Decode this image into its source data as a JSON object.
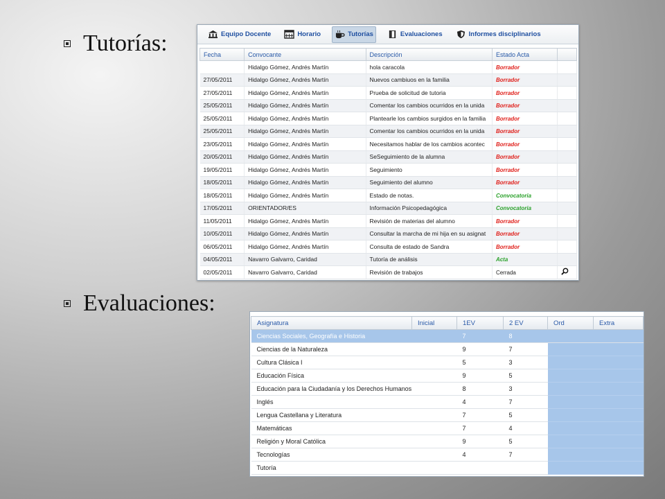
{
  "bullets": {
    "tutorias": "Tutorías:",
    "evaluaciones": "Evaluaciones:"
  },
  "toolbar": [
    {
      "label": "Equipo Docente",
      "icon": "building-icon"
    },
    {
      "label": "Horario",
      "icon": "calendar-icon"
    },
    {
      "label": "Tutorías",
      "icon": "coffee-icon",
      "active": true
    },
    {
      "label": "Evaluaciones",
      "icon": "book-icon"
    },
    {
      "label": "Informes disciplinarios",
      "icon": "shield-icon"
    }
  ],
  "tutorias": {
    "columns": [
      "Fecha",
      "Convocante",
      "Descripción",
      "Estado Acta"
    ],
    "status_colors": {
      "Borrador": "#e0201b",
      "Convocatoria": "#2aa12a",
      "Acta": "#2aa12a",
      "Cerrada": "#222222"
    },
    "rows": [
      {
        "fecha": "",
        "convocante": "Hidalgo Gómez, Andrés Martín",
        "descripcion": "hola caracola",
        "estado": "Borrador"
      },
      {
        "fecha": "27/05/2011",
        "convocante": "Hidalgo Gómez, Andrés Martín",
        "descripcion": "Nuevos cambiuos en la familia",
        "estado": "Borrador"
      },
      {
        "fecha": "27/05/2011",
        "convocante": "Hidalgo Gómez, Andrés Martín",
        "descripcion": "Prueba de solicitud de tutoria",
        "estado": "Borrador"
      },
      {
        "fecha": "25/05/2011",
        "convocante": "Hidalgo Gómez, Andrés Martín",
        "descripcion": "Comentar los cambios ocurridos en la unida",
        "estado": "Borrador"
      },
      {
        "fecha": "25/05/2011",
        "convocante": "Hidalgo Gómez, Andrés Martín",
        "descripcion": "Plantearle los cambios surgidos en la familia",
        "estado": "Borrador"
      },
      {
        "fecha": "25/05/2011",
        "convocante": "Hidalgo Gómez, Andrés Martín",
        "descripcion": "Comentar los cambios ocurridos en la unida",
        "estado": "Borrador"
      },
      {
        "fecha": "23/05/2011",
        "convocante": "Hidalgo Gómez, Andrés Martín",
        "descripcion": "Necesitamos hablar de los cambios acontec",
        "estado": "Borrador"
      },
      {
        "fecha": "20/05/2011",
        "convocante": "Hidalgo Gómez, Andrés Martín",
        "descripcion": "SeSeguimiento de la alumna",
        "estado": "Borrador"
      },
      {
        "fecha": "19/05/2011",
        "convocante": "Hidalgo Gómez, Andrés Martín",
        "descripcion": "Seguimiento",
        "estado": "Borrador"
      },
      {
        "fecha": "18/05/2011",
        "convocante": "Hidalgo Gómez, Andrés Martín",
        "descripcion": "Seguimiento del alumno",
        "estado": "Borrador"
      },
      {
        "fecha": "18/05/2011",
        "convocante": "Hidalgo Gómez, Andrés Martín",
        "descripcion": "Estado de notas.",
        "estado": "Convocatoria"
      },
      {
        "fecha": "17/05/2011",
        "convocante": "ORIENTADOR/ES",
        "descripcion": "Información Psicopedagógica",
        "estado": "Convocatoria"
      },
      {
        "fecha": "11/05/2011",
        "convocante": "Hidalgo Gómez, Andrés Martín",
        "descripcion": "Revisión de materias del alumno",
        "estado": "Borrador"
      },
      {
        "fecha": "10/05/2011",
        "convocante": "Hidalgo Gómez, Andrés Martín",
        "descripcion": "Consultar la marcha de mi hija en su asignat",
        "estado": "Borrador"
      },
      {
        "fecha": "06/05/2011",
        "convocante": "Hidalgo Gómez, Andrés Martín",
        "descripcion": "Consulta de estado de Sandra",
        "estado": "Borrador"
      },
      {
        "fecha": "04/05/2011",
        "convocante": "Navarro Galvarro, Caridad",
        "descripcion": "Tutoría de análisis",
        "estado": "Acta"
      },
      {
        "fecha": "02/05/2011",
        "convocante": "Navarro Galvarro, Caridad",
        "descripcion": "Revisión de trabajos",
        "estado": "Cerrada",
        "icon": "magnifier-icon"
      }
    ]
  },
  "evaluaciones": {
    "columns": [
      "Asignatura",
      "Inicial",
      "1EV",
      "2 EV",
      "Ord",
      "Extra"
    ],
    "rows": [
      {
        "asignatura": "Ciencias Sociales, Geografía e Historia",
        "inicial": "",
        "ev1": "7",
        "ev2": "8",
        "ord": "",
        "extra": "",
        "selected": true
      },
      {
        "asignatura": "Ciencias de la Naturaleza",
        "inicial": "",
        "ev1": "9",
        "ev2": "7",
        "ord": "",
        "extra": ""
      },
      {
        "asignatura": "Cultura Clásica I",
        "inicial": "",
        "ev1": "5",
        "ev2": "3",
        "ord": "",
        "extra": ""
      },
      {
        "asignatura": "Educación Física",
        "inicial": "",
        "ev1": "9",
        "ev2": "5",
        "ord": "",
        "extra": ""
      },
      {
        "asignatura": "Educación para la Ciudadanía y los Derechos Humanos",
        "inicial": "",
        "ev1": "8",
        "ev2": "3",
        "ord": "",
        "extra": ""
      },
      {
        "asignatura": "Inglés",
        "inicial": "",
        "ev1": "4",
        "ev2": "7",
        "ord": "",
        "extra": ""
      },
      {
        "asignatura": "Lengua Castellana y Literatura",
        "inicial": "",
        "ev1": "7",
        "ev2": "5",
        "ord": "",
        "extra": ""
      },
      {
        "asignatura": "Matemáticas",
        "inicial": "",
        "ev1": "7",
        "ev2": "4",
        "ord": "",
        "extra": ""
      },
      {
        "asignatura": "Religión y Moral Católica",
        "inicial": "",
        "ev1": "9",
        "ev2": "5",
        "ord": "",
        "extra": ""
      },
      {
        "asignatura": "Tecnologías",
        "inicial": "",
        "ev1": "4",
        "ev2": "7",
        "ord": "",
        "extra": ""
      },
      {
        "asignatura": "Tutoría",
        "inicial": "",
        "ev1": "",
        "ev2": "",
        "ord": "",
        "extra": ""
      }
    ]
  }
}
